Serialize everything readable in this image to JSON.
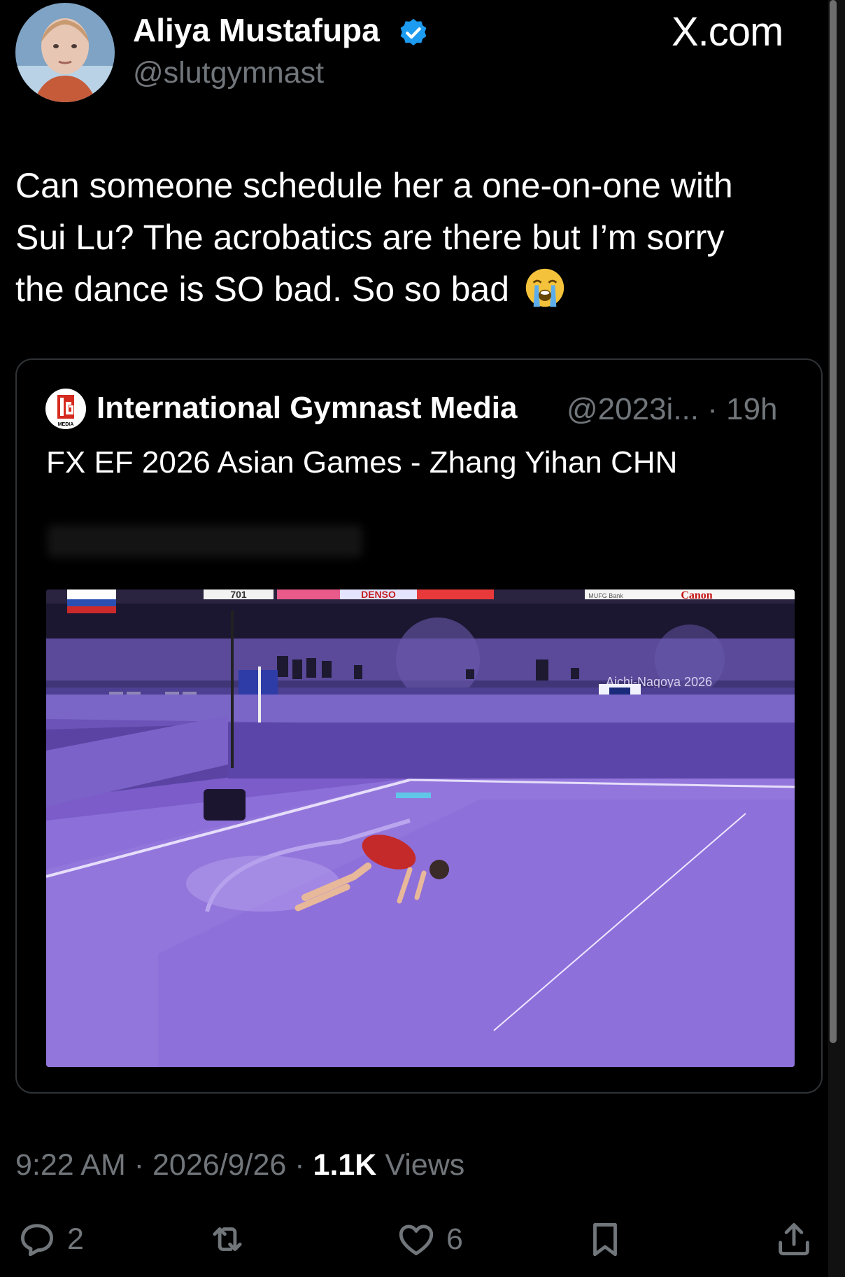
{
  "tweet": {
    "author_name": "Aliya Mustafupa",
    "handle": "@slutgymnast",
    "site_label": "X.com",
    "text_lines": [
      "Can someone schedule her a one-on-one with",
      "Sui Lu? The acrobatics are there but I’m sorry",
      "the dance is SO bad. So so bad"
    ],
    "emoji": "loudly-crying-face-emoji",
    "time": "9:22 AM",
    "date": "2026/9/26",
    "views_count": "1.1K",
    "views_label": "Views",
    "sep": "·"
  },
  "quote": {
    "author_name": "International Gymnast Media",
    "handle_time": "@2023i... · 19h",
    "text": "FX EF 2026 Asian Games - Zhang Yihan CHN",
    "logo_text": "MEDIA"
  },
  "actions": {
    "replies": "2",
    "likes": "6"
  },
  "video": {
    "banner_texts": [
      "701",
      "DENSO",
      "MUFG Bank",
      "Canon"
    ],
    "board_text": "Aichi-Nagoya 2026"
  },
  "colors": {
    "background": "#000000",
    "text": "#e7e9ea",
    "muted": "#71767b",
    "verified": "#1d9bf0",
    "floor": "#8b66d6"
  }
}
